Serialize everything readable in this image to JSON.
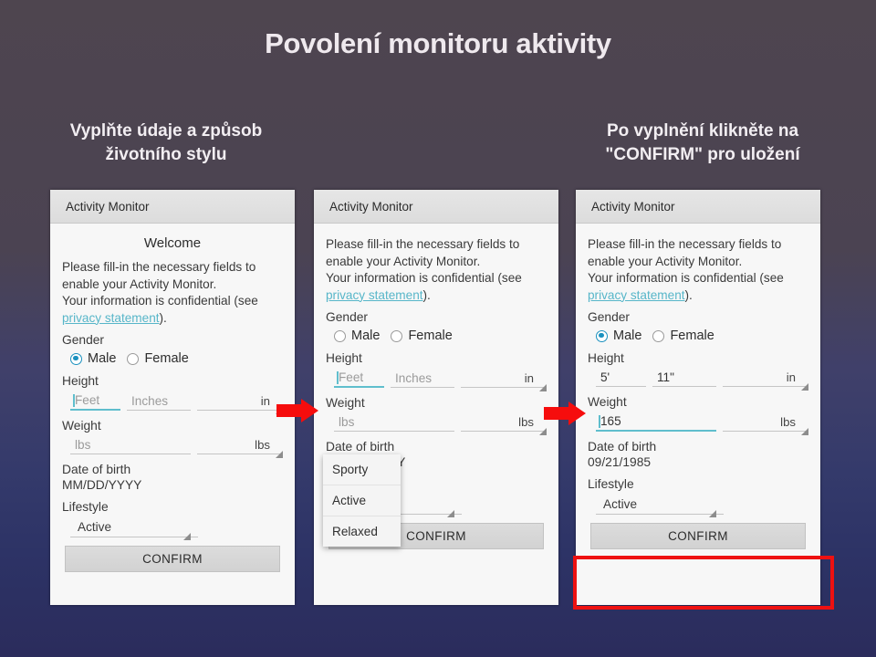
{
  "slide": {
    "title": "Povolení monitoru aktivity",
    "subtitle_left": "Vyplňte údaje a způsob životního stylu",
    "subtitle_right": "Po vyplnění klikněte na \"CONFIRM\" pro uložení"
  },
  "common": {
    "app_title": "Activity Monitor",
    "welcome": "Welcome",
    "intro_line1": "Please fill-in the necessary fields to",
    "intro_line2": "enable your Activity Monitor.",
    "intro_line3": "Your information is confidential (see",
    "intro_link": "privacy statement",
    "intro_tail": ").",
    "gender_label": "Gender",
    "male_label": "Male",
    "female_label": "Female",
    "height_label": "Height",
    "weight_label": "Weight",
    "dob_label": "Date of birth",
    "lifestyle_label": "Lifestyle",
    "confirm_label": "CONFIRM",
    "feet_placeholder": "Feet",
    "inches_placeholder": "Inches",
    "lbs_placeholder": "lbs",
    "unit_in": "in",
    "unit_lbs": "lbs"
  },
  "panel1": {
    "app_title": "Activity Monitor",
    "gender_selected": "Male",
    "feet_value": "",
    "inches_value": "",
    "weight_value": "",
    "dob_value": "MM/DD/YYYY",
    "lifestyle_value": "Active",
    "confirm_label": "CONFIRM"
  },
  "panel2": {
    "app_title": "Activity Monitor",
    "gender_selected": "",
    "feet_value": "",
    "inches_value": "",
    "weight_value": "",
    "dob_value": "MM/DD/YYYY",
    "lifestyle_value": "Active",
    "confirm_label": "CONFIRM",
    "dropdown_options": [
      "Sporty",
      "Active",
      "Relaxed"
    ]
  },
  "panel3": {
    "app_title": "Activity Monitor",
    "gender_selected": "Male",
    "feet_value": "5'",
    "inches_value": "11\"",
    "weight_value": "165",
    "dob_value": "09/21/1985",
    "lifestyle_value": "Active",
    "confirm_label": "CONFIRM"
  },
  "colors": {
    "accent_teal": "#1a91bf",
    "link": "#57b6c9",
    "highlight_red": "#ee1111",
    "arrow_red": "#f60d0d",
    "bg_top": "#4e454f",
    "bg_bottom": "#2b2c5c"
  }
}
